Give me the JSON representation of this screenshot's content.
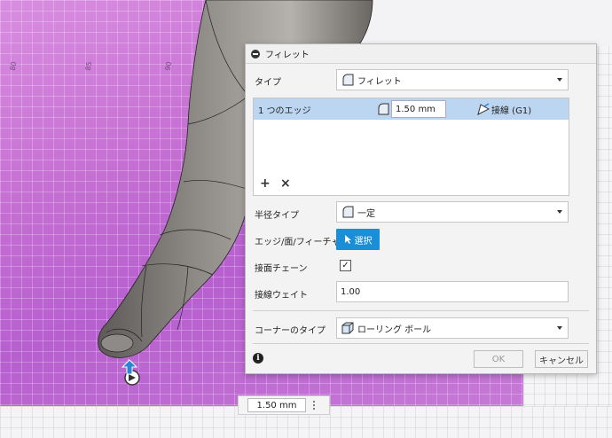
{
  "viewport": {
    "ruler_ticks": [
      "80",
      "85",
      "90"
    ]
  },
  "dialog": {
    "title": "フィレット",
    "type": {
      "label": "タイプ",
      "value": "フィレット"
    },
    "edge_table": {
      "row": {
        "name": "1 つのエッジ",
        "radius": "1.50 mm",
        "continuity": "接線 (G1)"
      }
    },
    "radius_type": {
      "label": "半径タイプ",
      "value": "一定"
    },
    "edges_faces": {
      "label": "エッジ/面/フィーチャ",
      "button": "選択"
    },
    "tangent_chain": {
      "label": "接面チェーン",
      "checked": true
    },
    "tangency_weight": {
      "label": "接線ウェイト",
      "value": "1.00"
    },
    "corner_type": {
      "label": "コーナーのタイプ",
      "value": "ローリング ボール"
    },
    "ok_label": "OK",
    "cancel_label": "キャンセル"
  },
  "floating_input": {
    "value": "1.50 mm"
  },
  "colors": {
    "accent": "#1a8ed6",
    "selected_row": "#bcd6f1",
    "plane": "#c56fd3"
  }
}
